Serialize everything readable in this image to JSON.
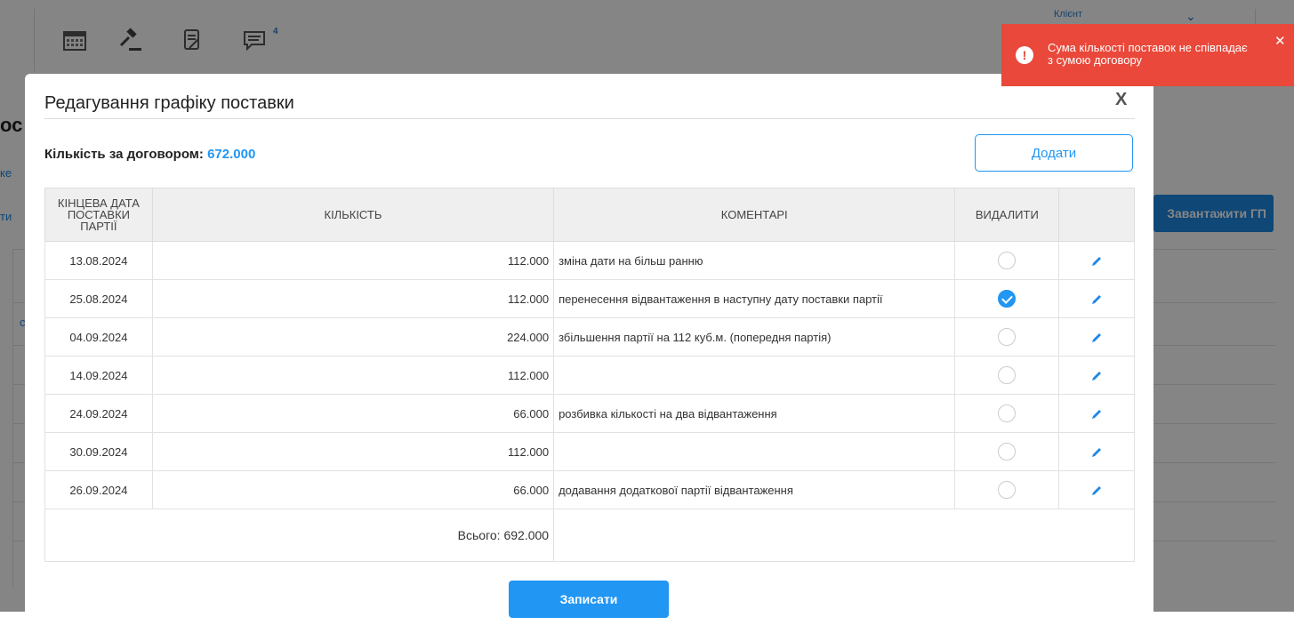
{
  "background": {
    "client_label": "Клієнт",
    "load_button": "Завантажити ГП",
    "notifications_count": "4",
    "side_text": "ос",
    "left_links": [
      "ке",
      "ти",
      "с"
    ]
  },
  "modal": {
    "title": "Редагування графіку поставки",
    "close": "X",
    "qty_label": "Кількість за договором:",
    "qty_value": "672.000",
    "add_button": "Додати",
    "columns": {
      "date": "Кінцева дата поставки партії",
      "quantity": "Кількість",
      "comments": "Коментарі",
      "delete": "Видалити",
      "edit": ""
    },
    "rows": [
      {
        "date": "13.08.2024",
        "quantity": "112.000",
        "comment": "зміна дати на більш ранню",
        "delete": false
      },
      {
        "date": "25.08.2024",
        "quantity": "112.000",
        "comment": "перенесення відвантаження в наступну дату поставки партії",
        "delete": true
      },
      {
        "date": "04.09.2024",
        "quantity": "224.000",
        "comment": "збільшення партії на 112 куб.м. (попередня партія)",
        "delete": false
      },
      {
        "date": "14.09.2024",
        "quantity": "112.000",
        "comment": "",
        "delete": false
      },
      {
        "date": "24.09.2024",
        "quantity": "66.000",
        "comment": "розбивка кількості на два відвантаження",
        "delete": false
      },
      {
        "date": "30.09.2024",
        "quantity": "112.000",
        "comment": "",
        "delete": false
      },
      {
        "date": "26.09.2024",
        "quantity": "66.000",
        "comment": "додавання додаткової партії відвантаження",
        "delete": false
      }
    ],
    "total": "Всього: 692.000",
    "save_button": "Записати"
  },
  "toast": {
    "message": "Сума кількості поставок не співпадає з сумою договору",
    "icon": "exclamation-icon",
    "color": "#e9483a"
  },
  "colors": {
    "accent": "#2196f3"
  }
}
